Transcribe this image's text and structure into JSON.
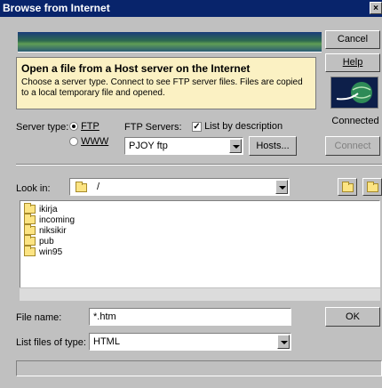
{
  "window": {
    "title": "Browse from Internet"
  },
  "buttons": {
    "cancel": "Cancel",
    "help": "Help",
    "connect": "Connect",
    "hosts": "Hosts...",
    "ok": "OK"
  },
  "info": {
    "heading": "Open a file from a Host server on the Internet",
    "line1": "Choose a server type. Connect to see FTP server files. Files are copied",
    "line2": "to a local temporary file and opened."
  },
  "connection": {
    "status": "Connected"
  },
  "server": {
    "type_label": "Server type:",
    "options": [
      "FTP",
      "WWW"
    ],
    "selected": "FTP",
    "servers_label": "FTP Servers:",
    "list_by_description_label": "List by description",
    "list_by_description_checked": true,
    "selected_server": "PJOY ftp"
  },
  "look_in": {
    "label": "Look in:",
    "path": "/"
  },
  "files": [
    "ikirja",
    "incoming",
    "niksikir",
    "pub",
    "win95"
  ],
  "file_name": {
    "label": "File name:",
    "value": "*.htm"
  },
  "file_type": {
    "label": "List files of type:",
    "value": "HTML"
  },
  "colors": {
    "title_bar": "#08246b",
    "dialog": "#c0c0c0",
    "info_box": "#fbf1c3"
  }
}
